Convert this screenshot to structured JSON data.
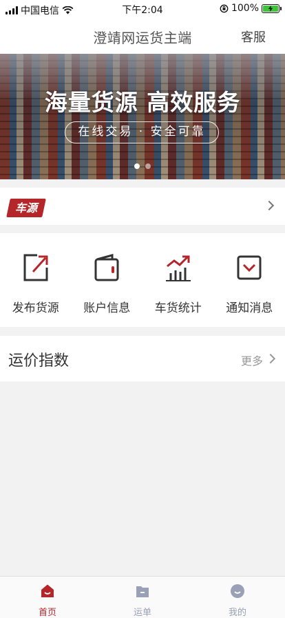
{
  "status_bar": {
    "carrier": "中国电信",
    "time": "下午2:04",
    "battery_percent": "100%"
  },
  "nav": {
    "title": "澄靖网运货主端",
    "service_label": "客服"
  },
  "banner": {
    "headline": "海量货源 高效服务",
    "tagline": "在线交易 · 安全可靠",
    "slide_count": 2,
    "active_slide": 1
  },
  "vehicle_source": {
    "tag_label": "车源"
  },
  "quick_menu": [
    {
      "label": "发布货源",
      "icon": "publish-icon"
    },
    {
      "label": "账户信息",
      "icon": "wallet-icon"
    },
    {
      "label": "车货统计",
      "icon": "stats-icon"
    },
    {
      "label": "通知消息",
      "icon": "notification-icon"
    }
  ],
  "freight_index": {
    "title": "运价指数",
    "more_label": "更多"
  },
  "tab_bar": [
    {
      "label": "首页",
      "icon": "home-icon",
      "active": true
    },
    {
      "label": "运单",
      "icon": "waybill-icon",
      "active": false
    },
    {
      "label": "我的",
      "icon": "profile-icon",
      "active": false
    }
  ],
  "colors": {
    "accent": "#b5262a",
    "inactive_tab": "#9aa0b5",
    "background": "#f2f2f2"
  }
}
